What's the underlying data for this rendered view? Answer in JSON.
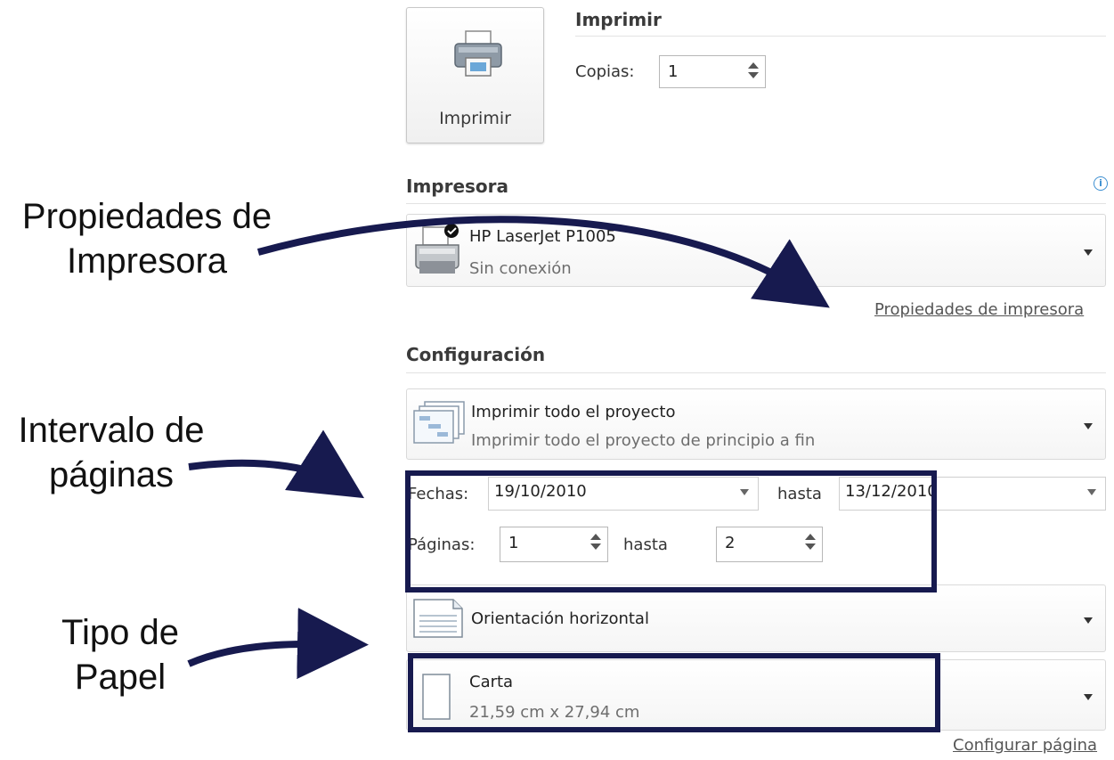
{
  "print": {
    "section_title": "Imprimir",
    "button_label": "Imprimir",
    "copies_label": "Copias:",
    "copies_value": "1"
  },
  "printer": {
    "section_title": "Impresora",
    "name": "HP LaserJet P1005",
    "status": "Sin conexión",
    "properties_link": "Propiedades de impresora",
    "info_icon": "info-icon"
  },
  "settings": {
    "section_title": "Configuración",
    "range": {
      "title": "Imprimir todo el proyecto",
      "subtitle": "Imprimir todo el proyecto de principio a fin"
    },
    "dates": {
      "label": "Fechas:",
      "from": "19/10/2010",
      "to_label": "hasta",
      "to": "13/12/2010"
    },
    "pages": {
      "label": "Páginas:",
      "from": "1",
      "to_label": "hasta",
      "to": "2"
    },
    "orientation": "Orientación horizontal",
    "paper": {
      "name": "Carta",
      "size": "21,59 cm x 27,94 cm"
    },
    "page_setup_link": "Configurar página"
  },
  "callouts": {
    "printer_properties": [
      "Propiedades de",
      "Impresora"
    ],
    "page_range": [
      "Intervalo de",
      "páginas"
    ],
    "paper_type": [
      "Tipo de",
      "Papel"
    ]
  },
  "colors": {
    "annotation": "#171a4f",
    "info": "#3d8fd1"
  }
}
